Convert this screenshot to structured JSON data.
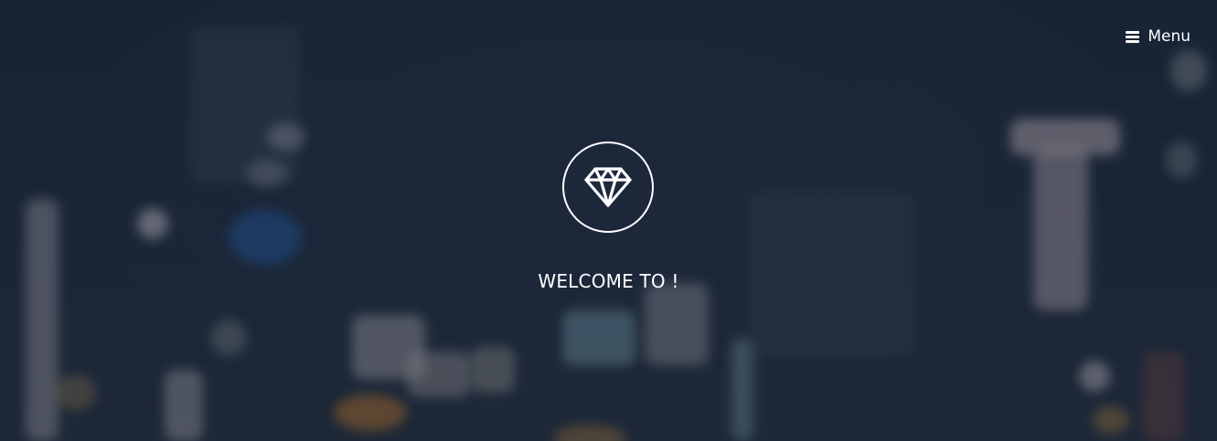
{
  "header": {
    "menu_label": "Menu",
    "menu_icon": "hamburger-icon"
  },
  "hero": {
    "logo_icon": "diamond-icon",
    "welcome_text": "WELCOME TO !"
  },
  "colors": {
    "background": "#1c2838",
    "foreground": "#ffffff"
  }
}
